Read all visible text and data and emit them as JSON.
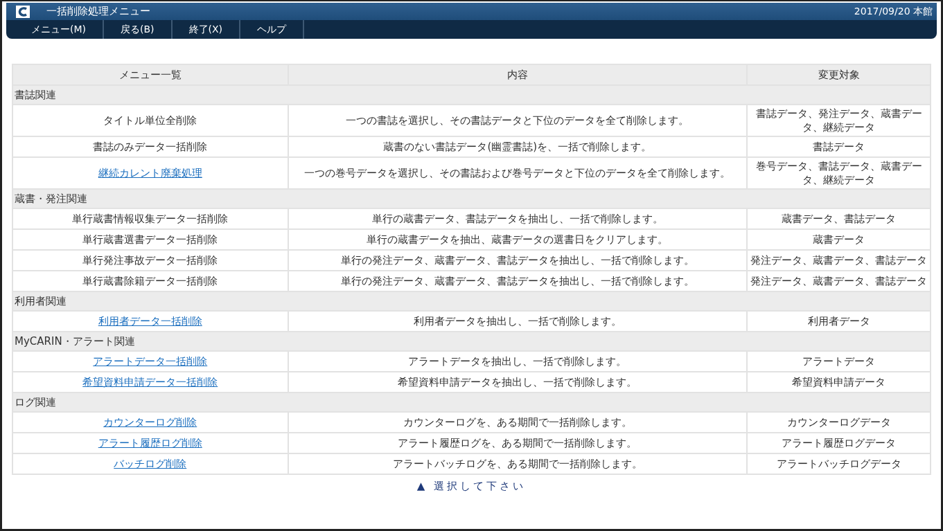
{
  "window": {
    "title": "一括削除処理メニュー",
    "info": "2017/09/20 本館"
  },
  "menu": [
    "メニュー(M)",
    "戻る(B)",
    "終了(X)",
    "ヘルプ"
  ],
  "table": {
    "columns": [
      "メニュー一覧",
      "内容",
      "変更対象"
    ],
    "groups": [
      {
        "title": "書誌関連",
        "rows": [
          {
            "kind": "text",
            "name": "タイトル単位全削除",
            "content": "一つの書誌を選択し、その書誌データと下位のデータを全て削除します。",
            "target": "書誌データ、発注データ、蔵書データ、継続データ"
          },
          {
            "kind": "text",
            "name": "書誌のみデータ一括削除",
            "content": "蔵書のない書誌データ(幽霊書誌)を、一括で削除します。",
            "target": "書誌データ"
          },
          {
            "kind": "link",
            "name": "継続カレント廃棄処理",
            "content": "一つの巻号データを選択し、その書誌および巻号データと下位のデータを全て削除します。",
            "target": "巻号データ、書誌データ、蔵書データ、継続データ"
          }
        ]
      },
      {
        "title": "蔵書・発注関連",
        "rows": [
          {
            "kind": "text",
            "name": "単行蔵書情報収集データ一括削除",
            "content": "単行の蔵書データ、書誌データを抽出し、一括で削除します。",
            "target": "蔵書データ、書誌データ"
          },
          {
            "kind": "text",
            "name": "単行蔵書選書データ一括削除",
            "content": "単行の蔵書データを抽出、蔵書データの選書日をクリアします。",
            "target": "蔵書データ"
          },
          {
            "kind": "text",
            "name": "単行発注事故データ一括削除",
            "content": "単行の発注データ、蔵書データ、書誌データを抽出し、一括で削除します。",
            "target": "発注データ、蔵書データ、書誌データ"
          },
          {
            "kind": "text",
            "name": "単行蔵書除籍データ一括削除",
            "content": "単行の発注データ、蔵書データ、書誌データを抽出し、一括で削除します。",
            "target": "発注データ、蔵書データ、書誌データ"
          }
        ]
      },
      {
        "title": "利用者関連",
        "rows": [
          {
            "kind": "link",
            "name": "利用者データ一括削除",
            "content": "利用者データを抽出し、一括で削除します。",
            "target": "利用者データ"
          }
        ]
      },
      {
        "title": "MyCARIN・アラート関連",
        "rows": [
          {
            "kind": "link",
            "name": "アラートデータ一括削除",
            "content": "アラートデータを抽出し、一括で削除します。",
            "target": "アラートデータ"
          },
          {
            "kind": "link",
            "name": "希望資料申請データ一括削除",
            "content": "希望資料申請データを抽出し、一括で削除します。",
            "target": "希望資料申請データ"
          }
        ]
      },
      {
        "title": "ログ関連",
        "rows": [
          {
            "kind": "link",
            "name": "カウンターログ削除",
            "content": "カウンターログを、ある期間で一括削除します。",
            "target": "カウンターログデータ"
          },
          {
            "kind": "link",
            "name": "アラート履歴ログ削除",
            "content": "アラート履歴ログを、ある期間で一括削除します。",
            "target": "アラート履歴ログデータ"
          },
          {
            "kind": "link",
            "name": "バッチログ削除",
            "content": "アラートバッチログを、ある期間で一括削除します。",
            "target": "アラートバッチログデータ"
          }
        ]
      }
    ]
  },
  "footer": "▲ 選択して下さい"
}
